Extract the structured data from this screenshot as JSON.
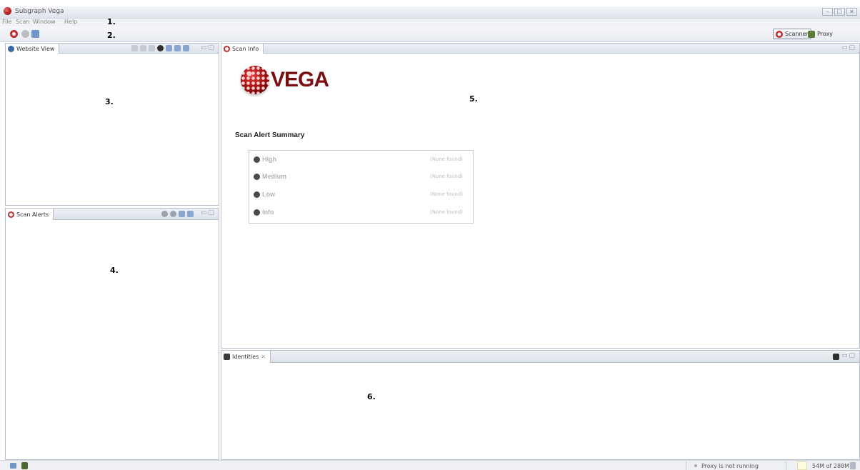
{
  "window": {
    "title": "Subgraph Vega",
    "controls": [
      "–",
      "☐",
      "✕"
    ]
  },
  "menu": {
    "items": [
      "File",
      "Scan",
      "Window",
      "Help"
    ]
  },
  "annotations": [
    "1.",
    "2.",
    "3.",
    "4.",
    "5.",
    "6."
  ],
  "toolbar": {
    "icons": [
      "new-scan-icon",
      "stop-scan-icon",
      "identity-icon"
    ],
    "perspectives": [
      {
        "label": "Scanner",
        "icon": "scanner-icon",
        "active": true
      },
      {
        "label": "Proxy",
        "icon": "proxy-icon",
        "active": false
      }
    ]
  },
  "website_view": {
    "tab": "Website View",
    "tools": [
      "home-icon",
      "back-icon",
      "forward-icon",
      "eye-icon",
      "identity-icon",
      "expand-icon",
      "collapse-icon"
    ]
  },
  "scan_alerts": {
    "tab": "Scan Alerts",
    "tools": [
      "pause-icon",
      "stop-icon",
      "expand-icon",
      "collapse-icon"
    ]
  },
  "scan_info": {
    "tab": "Scan Info",
    "logo_text": "VEGA",
    "summary_title": "Scan Alert Summary",
    "severities": [
      {
        "label": "High",
        "value": "(None found)",
        "icon": "high-icon"
      },
      {
        "label": "Medium",
        "value": "(None found)",
        "icon": "medium-icon"
      },
      {
        "label": "Low",
        "value": "(None found)",
        "icon": "low-icon"
      },
      {
        "label": "Info",
        "value": "(None found)",
        "icon": "info-icon"
      }
    ]
  },
  "identities": {
    "tab": "Identities",
    "close": "✕"
  },
  "status": {
    "proxy": "Proxy is not running",
    "memory": "54M of 288M"
  },
  "colors": {
    "brand": "#7a0f12",
    "scanner_icon": "#c0282d"
  }
}
